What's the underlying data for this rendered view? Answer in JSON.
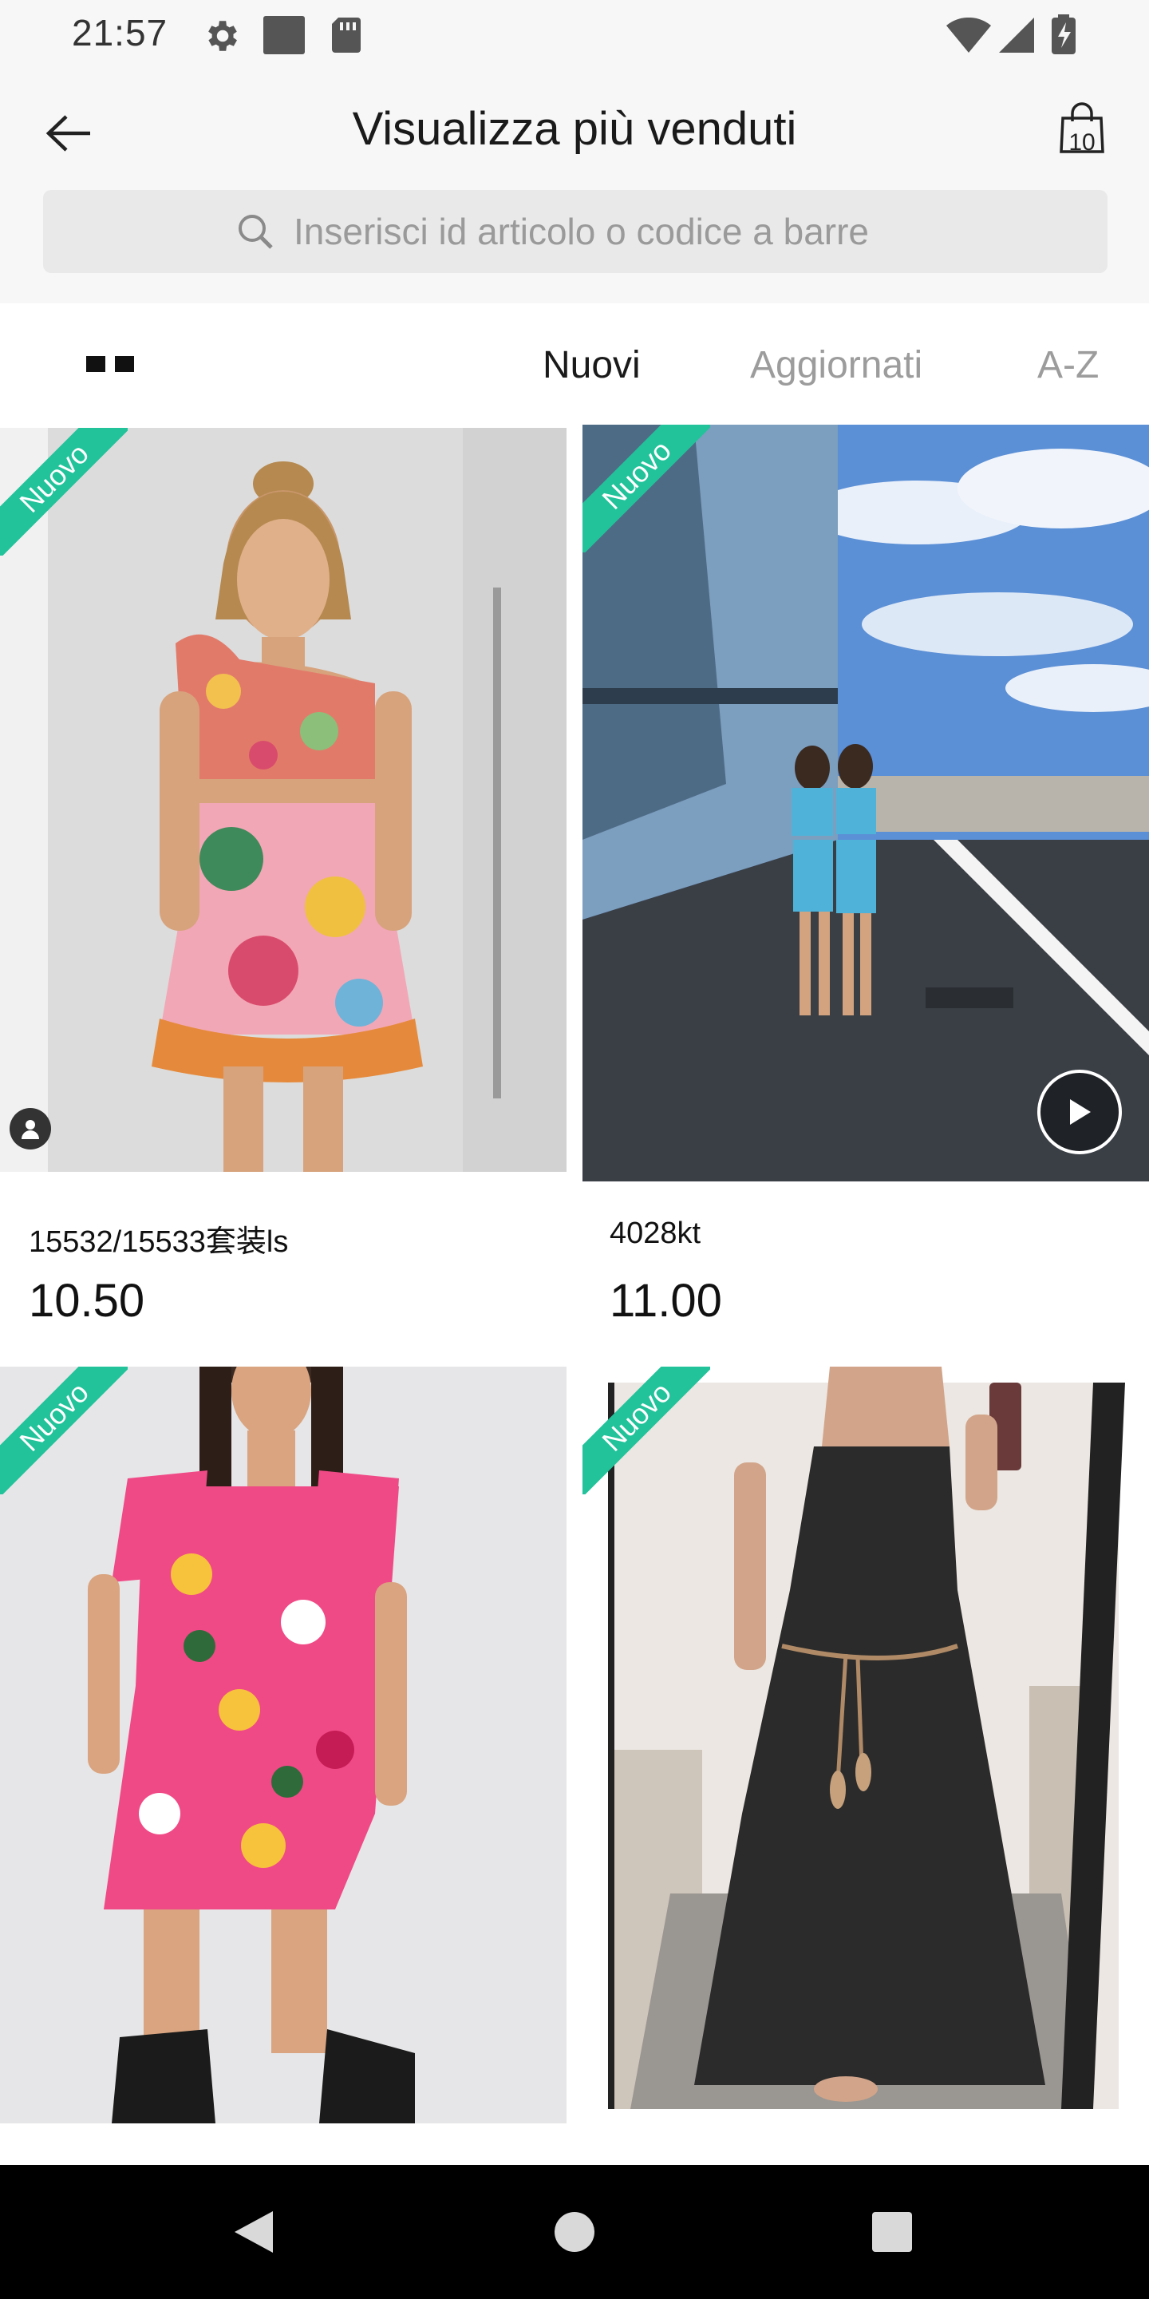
{
  "status_bar": {
    "time": "21:57",
    "icons": [
      "gear-icon",
      "notification-square-icon",
      "sd-card-icon",
      "wifi-icon",
      "signal-icon",
      "battery-charging-icon"
    ]
  },
  "header": {
    "title": "Visualizza più venduti",
    "cart_count": "10",
    "icons": {
      "back": "arrow-left-icon",
      "cart": "shopping-bag-icon"
    }
  },
  "search": {
    "placeholder": "Inserisci id articolo o codice a barre"
  },
  "sort_bar": {
    "view_icon": "grid-view-icon",
    "tabs": [
      {
        "label": "Nuovi",
        "active": true
      },
      {
        "label": "Aggiornati",
        "active": false
      },
      {
        "label": "A-Z",
        "active": false
      }
    ]
  },
  "products": [
    {
      "badge": "Nuovo",
      "name": "15532/15533套装ls",
      "price": "10.50",
      "image": "model in floral one-shoulder crop top and ruffled skirt"
    },
    {
      "badge": "Nuovo",
      "name": "4028kt",
      "price": "11.00",
      "image": "two models in blue outfits outdoors",
      "has_video": true
    },
    {
      "badge": "Nuovo",
      "name": "",
      "price": "",
      "image": "model in pink floral puff-sleeve dress"
    },
    {
      "badge": "Nuovo",
      "name": "",
      "price": "",
      "image": "black satin slip dress mirror selfie"
    }
  ],
  "colors": {
    "badge": "#22c39a",
    "header_bg": "#f7f7f7",
    "search_bg": "#e9e9e9"
  },
  "nav_bar": {
    "icons": [
      "back-triangle-icon",
      "home-circle-icon",
      "recents-square-icon"
    ]
  }
}
